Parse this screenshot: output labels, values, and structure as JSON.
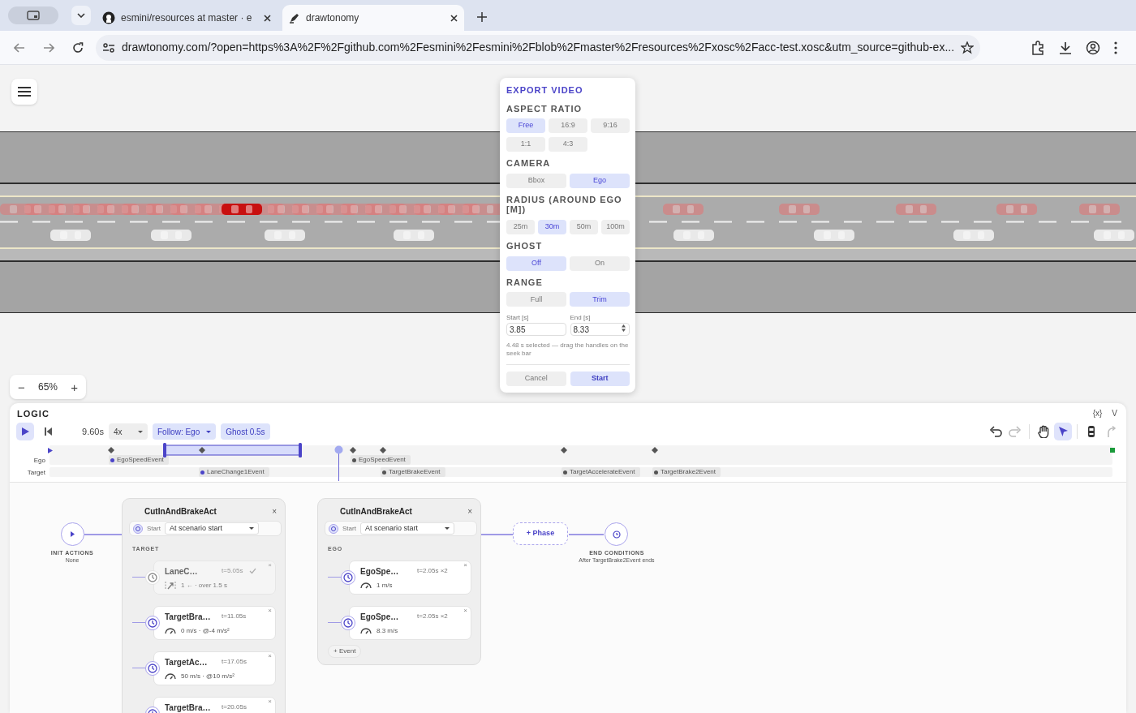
{
  "browser": {
    "tabs": [
      {
        "title": "esmini/resources at master · e",
        "selected": false
      },
      {
        "title": "drawtonomy",
        "selected": true
      }
    ],
    "url": "drawtonomy.com/?open=https%3A%2F%2Fgithub.com%2Fesmini%2Fesmini%2Fblob%2Fmaster%2Fresources%2Fxosc%2Facc-test.xosc&utm_source=github-ex..."
  },
  "zoom": {
    "minus": "−",
    "value": "65%",
    "plus": "+"
  },
  "export": {
    "title": "EXPORT VIDEO",
    "sections": [
      {
        "label": "ASPECT RATIO",
        "options": [
          {
            "label": "Free",
            "selected": true
          },
          {
            "label": "16:9",
            "selected": false
          },
          {
            "label": "9:16",
            "selected": false
          },
          {
            "label": "1:1",
            "selected": false
          },
          {
            "label": "4:3",
            "selected": false
          }
        ]
      },
      {
        "label": "CAMERA",
        "options": [
          {
            "label": "Bbox",
            "selected": false
          },
          {
            "label": "Ego",
            "selected": true
          }
        ]
      },
      {
        "label": "RADIUS (AROUND EGO [M])",
        "options": [
          {
            "label": "25m",
            "selected": false
          },
          {
            "label": "30m",
            "selected": true
          },
          {
            "label": "50m",
            "selected": false
          },
          {
            "label": "100m",
            "selected": false
          }
        ]
      },
      {
        "label": "GHOST",
        "options": [
          {
            "label": "Off",
            "selected": true
          },
          {
            "label": "On",
            "selected": false
          }
        ]
      },
      {
        "label": "RANGE",
        "options": [
          {
            "label": "Full",
            "selected": false
          },
          {
            "label": "Trim",
            "selected": true
          }
        ]
      }
    ],
    "start": {
      "label": "Start [s]",
      "value": "3.85"
    },
    "end": {
      "label": "End [s]",
      "value": "8.33"
    },
    "hint": "4.48 s selected — drag the handles on the seek bar",
    "cancel": "Cancel",
    "confirm": "Start"
  },
  "logic": {
    "title": "LOGIC",
    "vars": "{x}",
    "collapse": "V",
    "time": "9.60s",
    "speed": "4x",
    "follow": "Follow: Ego",
    "ghost": "Ghost 0.5s",
    "tools": [
      {
        "kind": "undo",
        "selected": false,
        "disabled": false
      },
      {
        "kind": "redo",
        "selected": false,
        "disabled": true
      },
      {
        "kind": "hand",
        "selected": false,
        "disabled": false
      },
      {
        "kind": "pointer",
        "selected": true,
        "disabled": false
      },
      {
        "kind": "car",
        "selected": false,
        "disabled": false
      },
      {
        "kind": "path",
        "selected": false,
        "disabled": true
      }
    ],
    "rows": [
      {
        "label": "Ego",
        "events": [
          {
            "name": "EgoSpeedEvent",
            "active": true
          },
          {
            "name": "EgoSpeedEvent",
            "active": false
          }
        ]
      },
      {
        "label": "Target",
        "events": [
          {
            "name": "LaneChange1Event",
            "active": true
          },
          {
            "name": "TargetBrakeEvent",
            "active": false
          },
          {
            "name": "TargetAccelerateEvent",
            "active": false
          },
          {
            "name": "TargetBrake2Event",
            "active": false
          }
        ]
      }
    ]
  },
  "diagram": {
    "init": {
      "label": "INIT ACTIONS",
      "value": "None"
    },
    "acts": [
      {
        "title": "CutInAndBrakeAct",
        "close": "×",
        "start_label": "Start",
        "start_value": "At scenario start",
        "group": "TARGET",
        "events": [
          {
            "title": "LaneC…",
            "time": "t=5.05s",
            "detail": "1 ← · over 1.5 s",
            "kind": "lane",
            "completed": true,
            "close": "×"
          },
          {
            "title": "TargetBra…",
            "time": "t=11.05s",
            "detail": "0 m/s  · @-4 m/s²",
            "kind": "speed",
            "completed": false,
            "close": "×"
          },
          {
            "title": "TargetAc…",
            "time": "t=17.05s",
            "detail": "50 m/s  · @10 m/s²",
            "kind": "speed",
            "completed": false,
            "close": "×"
          },
          {
            "title": "TargetBra…",
            "time": "t=20.05s",
            "completed": false,
            "close": "×"
          }
        ]
      },
      {
        "title": "CutInAndBrakeAct",
        "close": "×",
        "start_label": "Start",
        "start_value": "At scenario start",
        "group": "EGO",
        "add_event": "+ Event",
        "events": [
          {
            "title": "EgoSpe…",
            "time": "t=2.05s ×2",
            "detail": "1 m/s",
            "kind": "speed",
            "completed": false,
            "close": "×"
          },
          {
            "title": "EgoSpe…",
            "time": "t=2.05s ×2",
            "detail": "8.3 m/s",
            "kind": "speed",
            "completed": false,
            "close": "×"
          }
        ]
      }
    ],
    "phase": "+ Phase",
    "end": {
      "label": "END CONDITIONS",
      "value": "After TargetBrake2Event ends"
    }
  }
}
